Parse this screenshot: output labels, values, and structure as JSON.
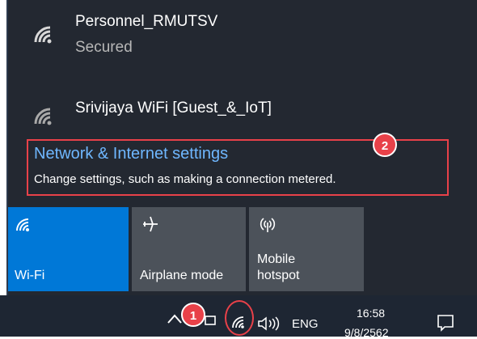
{
  "networks": [
    {
      "name": "Personnel_RMUTSV",
      "status": "Secured",
      "icon": "wifi-icon"
    },
    {
      "name": "Srivijaya WiFi [Guest_&_IoT]",
      "icon": "wifi-icon"
    }
  ],
  "settings_link": {
    "title": "Network & Internet settings",
    "description": "Change settings, such as making a connection metered."
  },
  "quick_actions": [
    {
      "label": "Wi-Fi",
      "active": true,
      "icon": "wifi-icon",
      "color": "#0078d7"
    },
    {
      "label": "Airplane mode",
      "active": false,
      "icon": "airplane-icon",
      "color": "#4c525a"
    },
    {
      "label": "Mobile\nhotspot",
      "active": false,
      "icon": "hotspot-icon",
      "color": "#4c525a"
    }
  ],
  "taskbar": {
    "language": "ENG",
    "time": "16:58",
    "date": "9/8/2562"
  },
  "annotations": {
    "badge_1": "1",
    "badge_2": "2",
    "highlight_color": "#e84149"
  },
  "colors": {
    "flyout_bg": "#232831",
    "link_blue": "#6fb7ff",
    "accent": "#0078d7",
    "taskbar_bg": "#1e2633"
  }
}
